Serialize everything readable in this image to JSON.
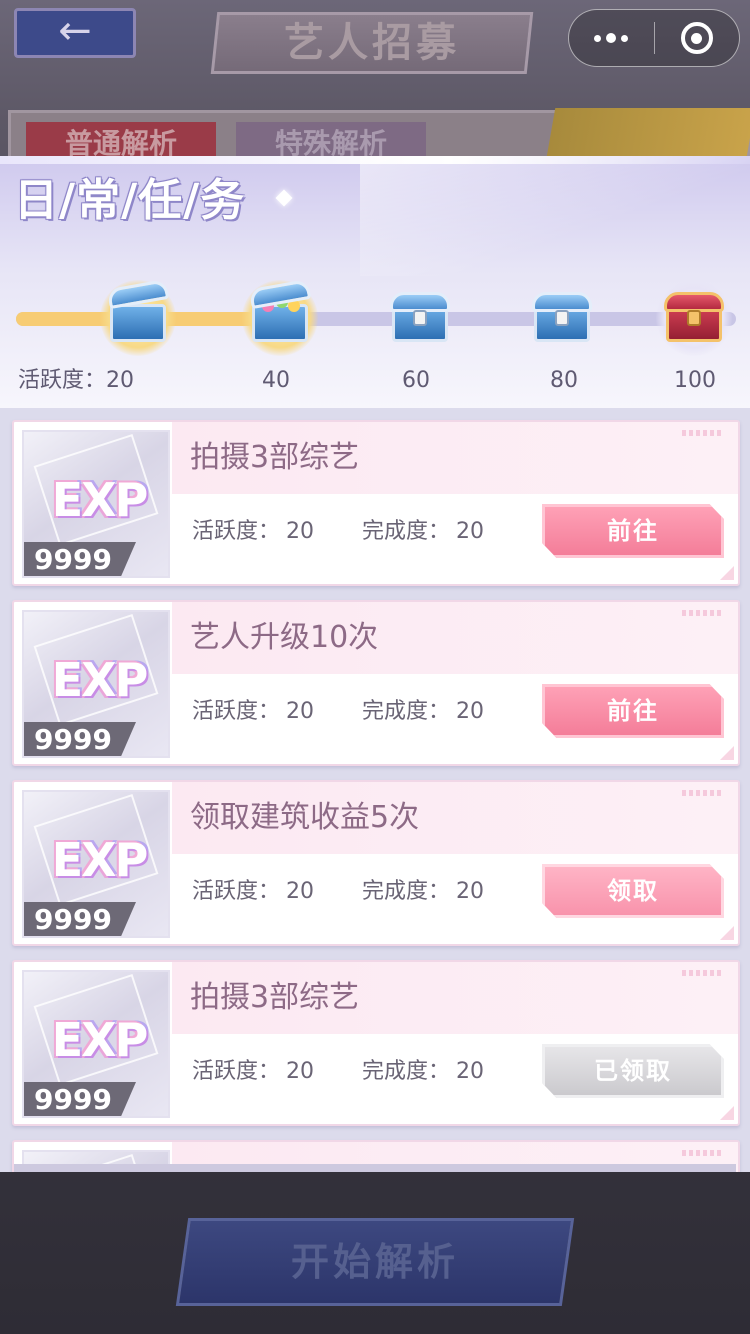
{
  "background": {
    "back_glyph": "←",
    "page_title": "艺人招募",
    "tab_normal": "普通解析",
    "tab_special": "特殊解析",
    "start_button": "开始解析"
  },
  "capsule": {
    "more_icon": "ellipsis-icon",
    "close_icon": "target-icon"
  },
  "panel": {
    "title": "日/常/任/务",
    "activity_prefix": "活跃度：",
    "current_activity": 20,
    "progress_fraction": 0.33,
    "milestones": [
      {
        "label": "20",
        "chest": "chest-open-icon",
        "claimed": true
      },
      {
        "label": "40",
        "chest": "chest-gems-icon",
        "claimed": true
      },
      {
        "label": "60",
        "chest": "chest-blue-icon",
        "claimed": false
      },
      {
        "label": "80",
        "chest": "chest-blue-icon",
        "claimed": false
      },
      {
        "label": "100",
        "chest": "chest-red-icon",
        "claimed": false
      }
    ]
  },
  "tasks": [
    {
      "name": "拍摄3部综艺",
      "reward_label": "EXP",
      "reward_qty": "9999",
      "activity_label": "活跃度：",
      "activity": "20",
      "progress_label": "完成度：",
      "progress": "20",
      "button": "前往",
      "state": "go"
    },
    {
      "name": "艺人升级10次",
      "reward_label": "EXP",
      "reward_qty": "9999",
      "activity_label": "活跃度：",
      "activity": "20",
      "progress_label": "完成度：",
      "progress": "20",
      "button": "前往",
      "state": "go"
    },
    {
      "name": "领取建筑收益5次",
      "reward_label": "EXP",
      "reward_qty": "9999",
      "activity_label": "活跃度：",
      "activity": "20",
      "progress_label": "完成度：",
      "progress": "20",
      "button": "领取",
      "state": "claim"
    },
    {
      "name": "拍摄3部综艺",
      "reward_label": "EXP",
      "reward_qty": "9999",
      "activity_label": "活跃度：",
      "activity": "20",
      "progress_label": "完成度：",
      "progress": "20",
      "button": "已领取",
      "state": "done"
    }
  ],
  "colors": {
    "progress_fill": "#f7cc74",
    "go_button": "#f37b97",
    "done_button": "#c9c8cc",
    "task_name": "#8d6a86"
  }
}
